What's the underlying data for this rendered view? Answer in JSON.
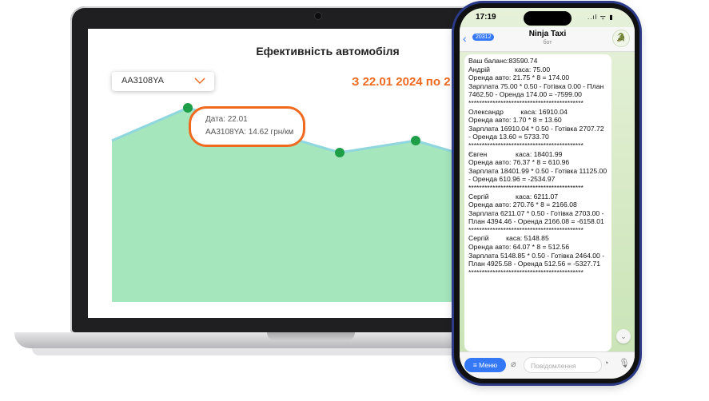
{
  "laptop": {
    "chart": {
      "title": "Ефективність автомобіля",
      "select_value": "AA3108YA",
      "date_range": "З 22.01 2024 по 2",
      "tooltip": {
        "line1": "Дата:  22.01",
        "line2": "AA3108YA: 14.62  грн/км"
      },
      "colors": {
        "area": "#a6e6bd",
        "line": "#8fd6df",
        "point": "#1f9e48",
        "accent": "#ef6a1f"
      }
    }
  },
  "chart_data": {
    "type": "area",
    "title": "Ефективність автомобіля",
    "series": [
      {
        "name": "AA3108YA",
        "x": [
          "22.01"
        ],
        "y": [
          14.62
        ]
      }
    ]
  },
  "phone": {
    "status": {
      "time": "17:19",
      "icons": "..ıl ᯤ ▮"
    },
    "chat": {
      "back_count": "20312",
      "name": "Ninja Taxi",
      "subtitle": "бот",
      "message": "Ваш баланс:83590.74\nАндрій             каса: 75.00\nОренда авто: 21.75 * 8 = 174.00\nЗарплата 75.00 * 0.50 - Готівка 0.00 - План 7462.50 - Оренда 174.00 = -7599.00\n*******************************************\nОлександр         каса: 16910.04\nОренда авто: 1.70 * 8 = 13.60\nЗарплата 16910.04 * 0.50 - Готівка 2707.72 - Оренда 13.60 = 5733.70\n*******************************************\nЄвген               каса: 18401.99\nОренда авто: 76.37 * 8 = 610.96\nЗарплата 18401.99 * 0.50 - Готівка 11125.00 - Оренда 610.96 = -2534.97\n*******************************************\nСергій              каса: 6211.07\nОренда авто: 270.76 * 8 = 2166.08\nЗарплата 6211.07 * 0.50 - Готівка 2703.00 - План 4394.46 - Оренда 2166.08 = -6158.01\n*******************************************\nСергій         каса: 5148.85\nОренда авто: 64.07 * 8 = 512.56\nЗарплата 5148.85 * 0.50 - Готівка 2464.00 - План 4925.58 - Оренда 512.56 = -5327.71\n*******************************************",
      "menu_label": "≡ Меню",
      "input_placeholder": "Повідомлення"
    }
  }
}
